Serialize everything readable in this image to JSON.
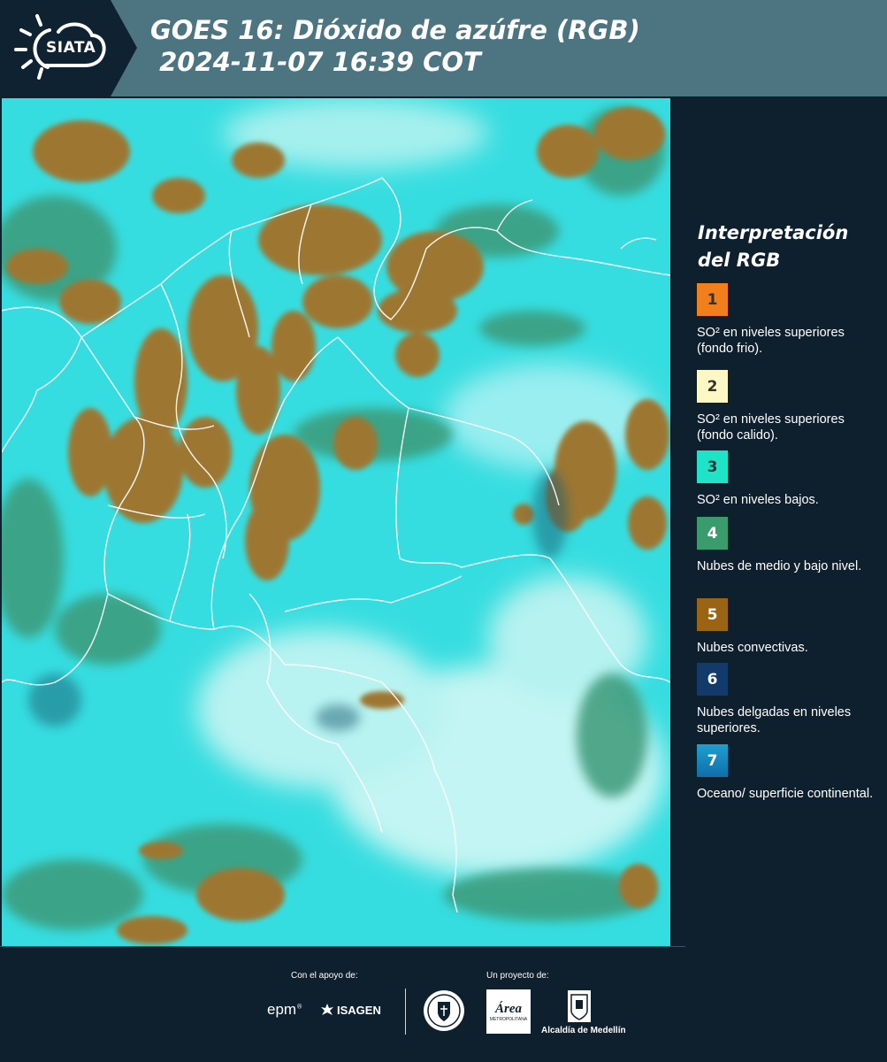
{
  "header": {
    "logo": "SIATA",
    "title_line1": "GOES 16: Dióxido de azúfre (RGB)",
    "title_line2": " 2024-11-07 16:39 COT"
  },
  "legend": {
    "title": "Interpretación del RGB",
    "items": [
      {
        "number": "1",
        "color": "#f07f1c",
        "label": "SO² en niveles superiores (fondo frio)."
      },
      {
        "number": "2",
        "color": "#fdf6c5",
        "label": "SO² en niveles superiores (fondo calido)."
      },
      {
        "number": "3",
        "color": "#1ee3c6",
        "label": "SO² en niveles bajos."
      },
      {
        "number": "4",
        "color": "#3a9b6c",
        "label": "Nubes de medio y bajo nivel."
      },
      {
        "number": "5",
        "color": "#9a6414",
        "label": "Nubes convectivas."
      },
      {
        "number": "6",
        "color": "#123a6a",
        "label": "Nubes delgadas en niveles superiores."
      },
      {
        "number": "7",
        "color": "#1591c6",
        "label": "Oceano/ superficie continental."
      }
    ]
  },
  "footer": {
    "support_label": "Con el apoyo de:",
    "project_label": "Un proyecto de:",
    "sponsor_epm": "epm",
    "sponsor_isagen": "ISAGEN",
    "partner_area": "Área",
    "partner_area_sub": "METROPOLITANA",
    "partner_alcaldia": "Alcaldía de Medellín"
  }
}
